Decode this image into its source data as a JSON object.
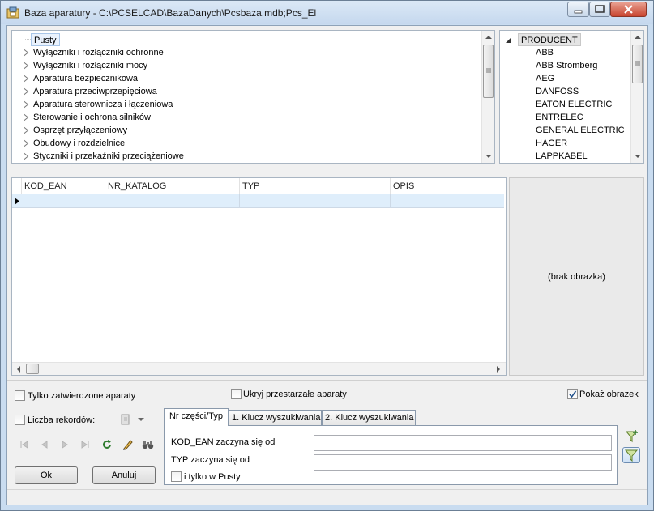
{
  "window": {
    "title": "Baza aparatury - C:\\PCSELCAD\\BazaDanych\\Pcsbaza.mdb;Pcs_El",
    "icon": "database-icon"
  },
  "category_tree": {
    "root_item": "Pusty",
    "items": [
      "Wyłączniki i rozłączniki ochronne",
      "Wyłączniki i rozłączniki mocy",
      "Aparatura bezpiecznikowa",
      "Aparatura przeciwprzepięciowa",
      "Aparatura sterownicza i łączeniowa",
      "Sterowanie i ochrona silników",
      "Osprzęt przyłączeniowy",
      "Obudowy i rozdzielnice",
      "Styczniki i przekaźniki przeciążeniowe"
    ]
  },
  "producer_tree": {
    "root_label": "PRODUCENT",
    "items": [
      "ABB",
      "ABB Stromberg",
      "AEG",
      "DANFOSS",
      "EATON ELECTRIC",
      "ENTRELEC",
      "GENERAL ELECTRIC",
      "HAGER",
      "LAPPKABEL"
    ]
  },
  "grid": {
    "columns": [
      "KOD_EAN",
      "NR_KATALOG",
      "TYP",
      "OPIS"
    ]
  },
  "image_panel": {
    "text": "(brak obrazka)"
  },
  "options": {
    "only_approved": {
      "label": "Tylko zatwierdzone aparaty",
      "checked": false
    },
    "hide_obsolete": {
      "label": "Ukryj przestarzałe aparaty",
      "checked": false
    },
    "show_image": {
      "label": "Pokaż obrazek",
      "checked": true
    },
    "record_count": {
      "label": "Liczba rekordów:",
      "checked": false
    }
  },
  "search_tabs": {
    "tabs": [
      "Nr części/Typ",
      "1. Klucz wyszukiwania",
      "2. Klucz wyszukiwania"
    ],
    "active": 0,
    "fields": [
      {
        "label": "KOD_EAN zaczyna się od",
        "value": ""
      },
      {
        "label": "TYP zaczyna się od",
        "value": ""
      }
    ],
    "only_in": {
      "label": "i tylko w Pusty",
      "checked": false
    }
  },
  "buttons": {
    "ok": "Ok",
    "cancel": "Anuluj"
  },
  "navigator_icons": [
    "first-record-icon",
    "prior-record-icon",
    "next-record-icon",
    "last-record-icon",
    "refresh-icon",
    "edit-icon",
    "binoculars-icon"
  ],
  "filter_icons": [
    "filter-add-icon",
    "filter-icon"
  ]
}
